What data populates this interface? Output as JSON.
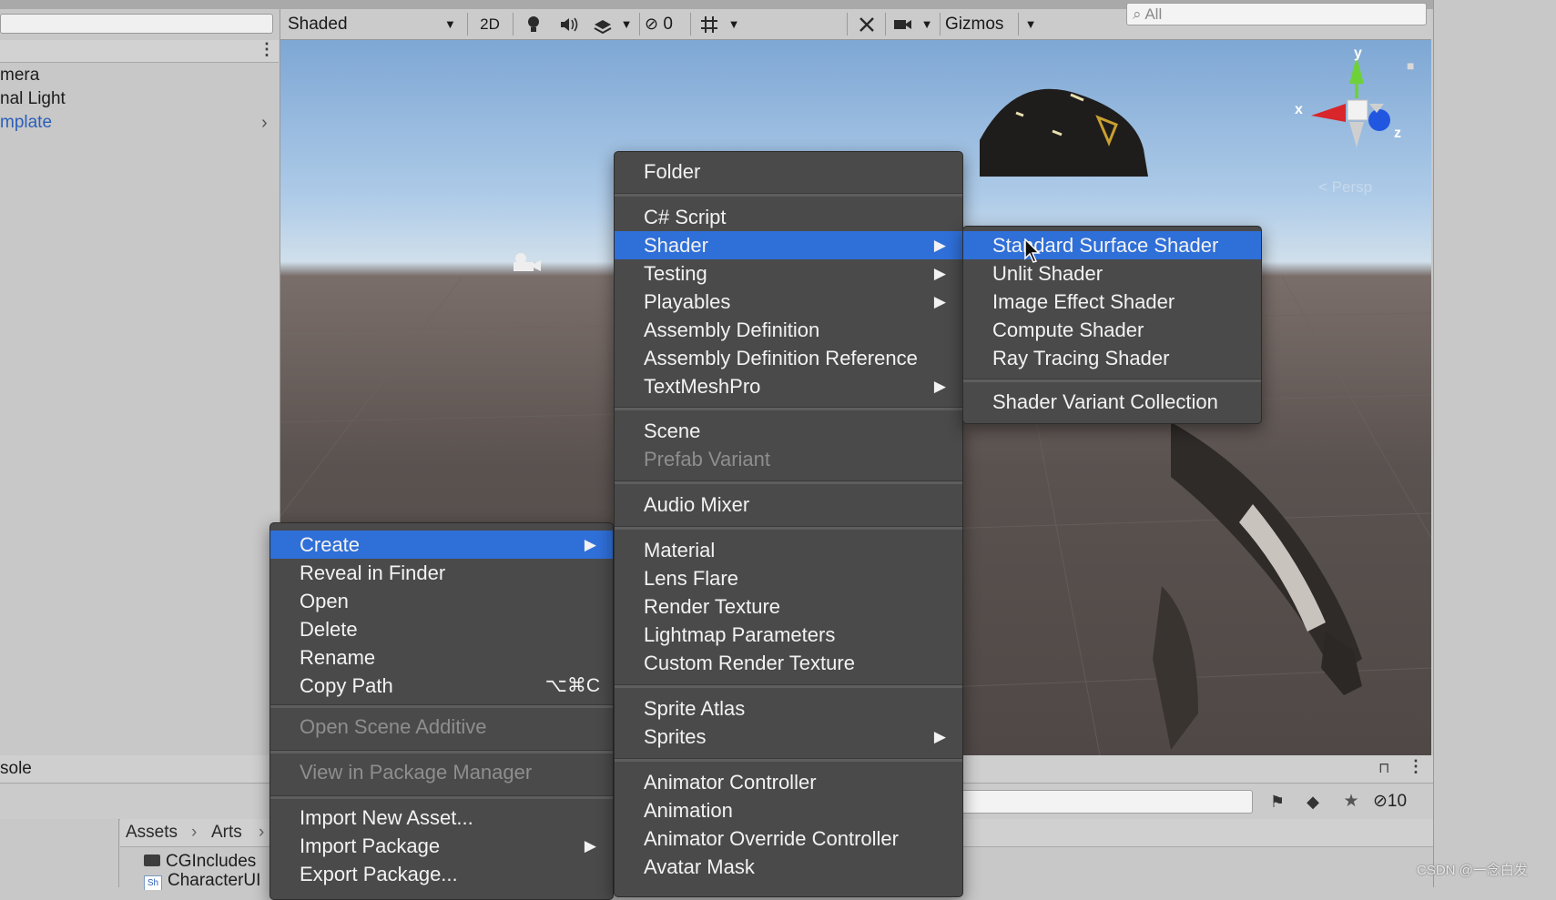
{
  "hierarchy": {
    "items": [
      "mera",
      "nal Light",
      "mplate"
    ],
    "item_template_color": "#2a5fb8"
  },
  "scene_toolbar": {
    "draw_mode": "Shaded",
    "mode_2d": "2D",
    "hidden_count": "0",
    "gizmos_label": "Gizmos",
    "search_placeholder": "All"
  },
  "gizmo": {
    "x": "x",
    "y": "y",
    "z": "z",
    "persp_label": "Persp"
  },
  "console": {
    "title": "sole",
    "hidden_count": "10",
    "breadcrumb": [
      "Assets",
      "Arts"
    ],
    "files": [
      "CGIncludes",
      "CharacterUI"
    ],
    "file_icon_text": "Sh"
  },
  "context_menu": {
    "items": [
      {
        "label": "Create",
        "selected": true,
        "submenu": true
      },
      {
        "label": "Reveal in Finder"
      },
      {
        "label": "Open"
      },
      {
        "label": "Delete"
      },
      {
        "label": "Rename"
      },
      {
        "label": "Copy Path",
        "shortcut": "⌥⌘C"
      },
      {
        "label": "Open Scene Additive",
        "disabled": true
      },
      {
        "label": "View in Package Manager",
        "disabled": true
      },
      {
        "label": "Import New Asset..."
      },
      {
        "label": "Import Package",
        "submenu": true
      },
      {
        "label": "Export Package..."
      }
    ]
  },
  "create_menu": {
    "items": [
      {
        "label": "Folder"
      },
      {
        "label": "C# Script"
      },
      {
        "label": "Shader",
        "selected": true,
        "submenu": true
      },
      {
        "label": "Testing",
        "submenu": true
      },
      {
        "label": "Playables",
        "submenu": true
      },
      {
        "label": "Assembly Definition"
      },
      {
        "label": "Assembly Definition Reference"
      },
      {
        "label": "TextMeshPro",
        "submenu": true
      },
      {
        "label": "Scene"
      },
      {
        "label": "Prefab Variant",
        "disabled": true
      },
      {
        "label": "Audio Mixer"
      },
      {
        "label": "Material"
      },
      {
        "label": "Lens Flare"
      },
      {
        "label": "Render Texture"
      },
      {
        "label": "Lightmap Parameters"
      },
      {
        "label": "Custom Render Texture"
      },
      {
        "label": "Sprite Atlas"
      },
      {
        "label": "Sprites",
        "submenu": true
      },
      {
        "label": "Animator Controller"
      },
      {
        "label": "Animation"
      },
      {
        "label": "Animator Override Controller"
      },
      {
        "label": "Avatar Mask"
      }
    ]
  },
  "shader_menu": {
    "items": [
      {
        "label": "Standard Surface Shader",
        "selected": true
      },
      {
        "label": "Unlit Shader"
      },
      {
        "label": "Image Effect Shader"
      },
      {
        "label": "Compute Shader"
      },
      {
        "label": "Ray Tracing Shader"
      },
      {
        "label": "Shader Variant Collection"
      }
    ]
  },
  "watermark": "CSDN @一念白发",
  "colors": {
    "menu_bg": "#4a4a4a",
    "selection": "#2f6fd8",
    "disabled_text": "#8e8e8e"
  }
}
